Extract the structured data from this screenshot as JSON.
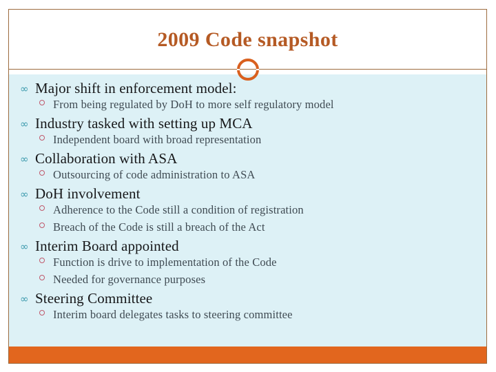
{
  "slide": {
    "title": "2009 Code snapshot",
    "theme": {
      "title_color": "#B55A24",
      "frame_border_color": "#9C6B3E",
      "ring_color": "#D9601E",
      "body_background": "#DDF1F6",
      "footer_bar_color": "#E2661E",
      "level1_bullet_color": "#3E9BAE",
      "level2_bullet_color": "#C0586B",
      "level1_text_color": "#17181A",
      "level2_text_color": "#3F4A52"
    },
    "decorations": {
      "ring_icon": "circle-ring-icon",
      "level1_bullet_glyph": "∞",
      "level2_bullet_glyph": "open-circle"
    },
    "content": [
      {
        "level": 1,
        "text": "Major shift in enforcement model:"
      },
      {
        "level": 2,
        "text": "From being regulated by DoH to more self regulatory model"
      },
      {
        "level": 1,
        "text": "Industry tasked with setting up MCA"
      },
      {
        "level": 2,
        "text": "Independent board with broad representation"
      },
      {
        "level": 1,
        "text": "Collaboration with ASA"
      },
      {
        "level": 2,
        "text": "Outsourcing of code administration to ASA"
      },
      {
        "level": 1,
        "text": "DoH involvement"
      },
      {
        "level": 2,
        "text": "Adherence to the Code still a condition of registration"
      },
      {
        "level": 2,
        "text": "Breach of the Code is still a breach of the Act"
      },
      {
        "level": 1,
        "text": "Interim Board appointed"
      },
      {
        "level": 2,
        "text": "Function is drive to implementation of the Code"
      },
      {
        "level": 2,
        "text": "Needed for governance purposes"
      },
      {
        "level": 1,
        "text": "Steering Committee"
      },
      {
        "level": 2,
        "text": "Interim board delegates tasks to steering committee"
      }
    ]
  }
}
